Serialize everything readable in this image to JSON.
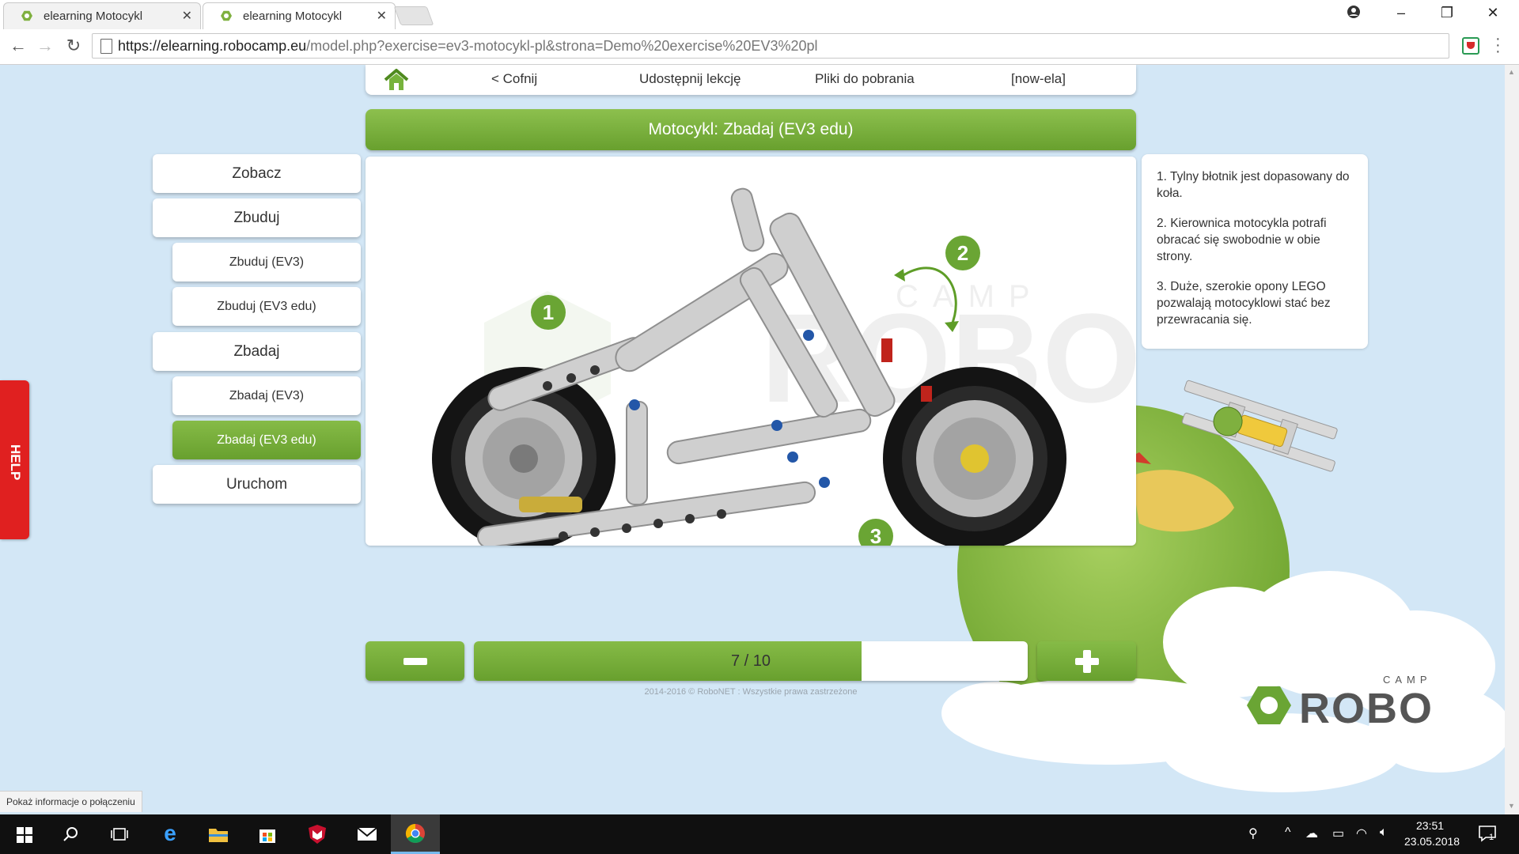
{
  "browser": {
    "tabs": [
      {
        "title": "elearning Motocykl"
      },
      {
        "title": "elearning Motocykl"
      }
    ],
    "url_host": "https://elearning.robocamp.eu",
    "url_path": "/model.php?exercise=ev3-motocykl-pl&strona=Demo%20exercise%20EV3%20pl",
    "status_bubble": "Pokaż informacje o połączeniu"
  },
  "topnav": {
    "back": "< Cofnij",
    "share": "Udostępnij lekcję",
    "downloads": "Pliki do pobrania",
    "user": "[now-ela]"
  },
  "lesson": {
    "title": "Motocykl: Zbadaj (EV3 edu)"
  },
  "sidebar": {
    "items": [
      {
        "label": "Zobacz"
      },
      {
        "label": "Zbuduj"
      },
      {
        "label": "Zbuduj (EV3)"
      },
      {
        "label": "Zbuduj (EV3 edu)"
      },
      {
        "label": "Zbadaj"
      },
      {
        "label": "Zbadaj (EV3)"
      },
      {
        "label": "Zbadaj (EV3 edu)"
      },
      {
        "label": "Uruchom"
      }
    ]
  },
  "help": {
    "label": "HELP"
  },
  "model": {
    "markers": [
      "1",
      "2",
      "3"
    ],
    "watermark": "CAMP",
    "watermark_brand": "ROBO"
  },
  "notes": [
    "1. Tylny błotnik jest dopasowany do koła.",
    "2. Kierownica motocykla potrafi obracać się swobodnie w obie strony.",
    "3. Duże, szerokie opony LEGO pozwalają motocyklowi stać bez przewracania się."
  ],
  "pager": {
    "current": 7,
    "total": 10,
    "label": "7 / 10",
    "progress_fraction": 0.7
  },
  "footer": "2014-2016 © RoboNET : Wszystkie prawa zastrzeżone",
  "logo": {
    "camp": "CAMP",
    "robo": "ROBO"
  },
  "taskbar": {
    "time": "23:51",
    "date": "23.05.2018",
    "notification_count": "1"
  },
  "colors": {
    "accent_green": "#7cb342",
    "help_red": "#e02020",
    "page_bg": "#d3e7f6"
  }
}
